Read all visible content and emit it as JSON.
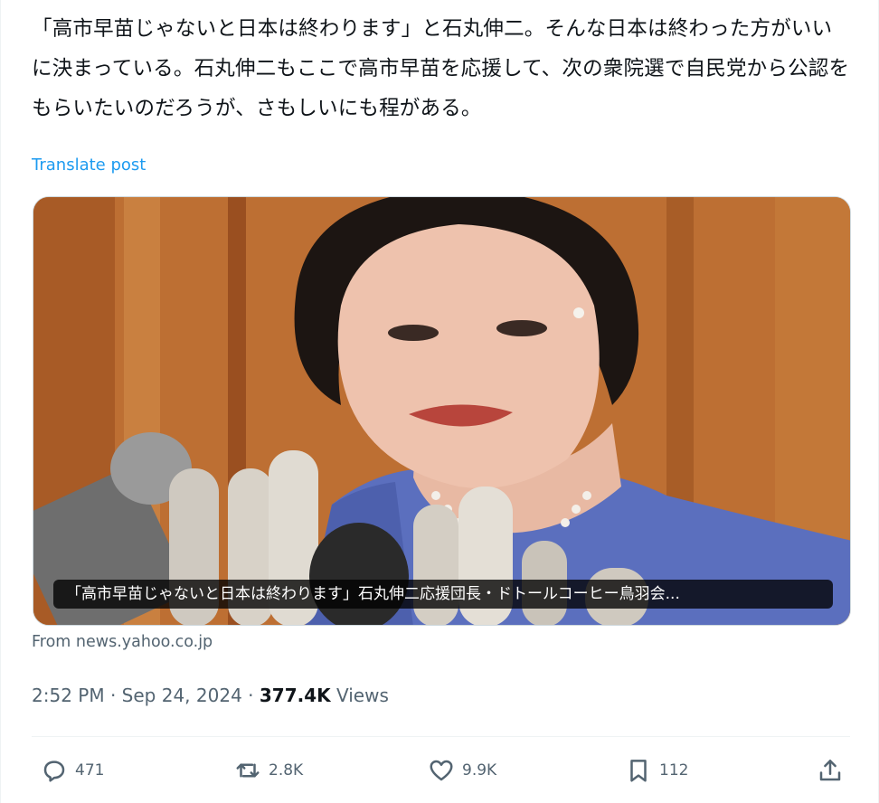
{
  "post": {
    "text": "「高市早苗じゃないと日本は終わります」と石丸伸二。そんな日本は終わった方がいいに決まっている。石丸伸二もここで高市早苗を応援して、次の衆院選で自民党から公認をもらいたいのだろうが、さもしいにも程がある。",
    "translate_label": "Translate post"
  },
  "card": {
    "caption": "「高市早苗じゃないと日本は終わります」石丸伸二応援団長・ドトールコーヒー鳥羽会...",
    "source": "From news.yahoo.co.jp"
  },
  "meta": {
    "time": "2:52 PM",
    "separator": "·",
    "date": "Sep 24, 2024",
    "views_count": "377.4K",
    "views_label": "Views"
  },
  "actions": {
    "replies": "471",
    "reposts": "2.8K",
    "likes": "9.9K",
    "bookmarks": "112"
  },
  "colors": {
    "accent": "#1d9bf0",
    "secondary_text": "#536471",
    "primary_text": "#0f1419"
  }
}
